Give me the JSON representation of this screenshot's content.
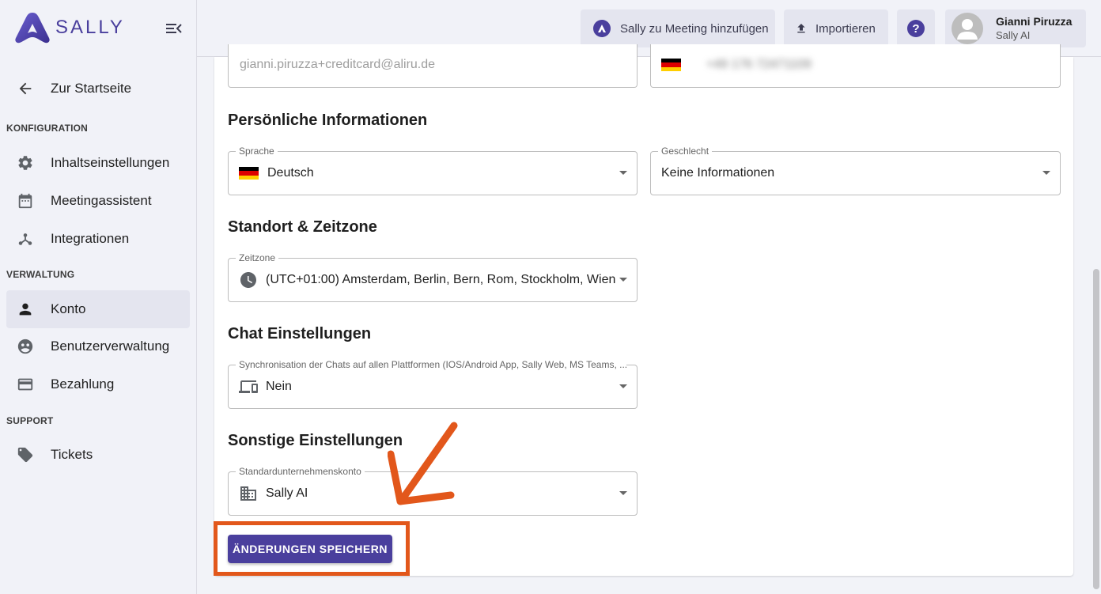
{
  "sidebar": {
    "logo_text": "SALLY",
    "back_label": "Zur Startseite",
    "sections": {
      "konfiguration": "KONFIGURATION",
      "verwaltung": "VERWALTUNG",
      "support": "SUPPORT"
    },
    "items": {
      "inhaltseinstellungen": "Inhaltseinstellungen",
      "meetingassistent": "Meetingassistent",
      "integrationen": "Integrationen",
      "konto": "Konto",
      "benutzerverwaltung": "Benutzerverwaltung",
      "bezahlung": "Bezahlung",
      "tickets": "Tickets"
    },
    "active_item": "Konto"
  },
  "topbar": {
    "add_meeting_label": "Sally zu Meeting hinzufügen",
    "import_label": "Importieren",
    "user_name": "Gianni Piruzza",
    "user_org": "Sally AI"
  },
  "form": {
    "email_value": "gianni.piruzza+creditcard@aliru.de",
    "phone_value": "+49 176 72471109",
    "personal_title": "Persönliche Informationen",
    "sprache_label": "Sprache",
    "sprache_value": "Deutsch",
    "geschlecht_label": "Geschlecht",
    "geschlecht_value": "Keine Informationen",
    "standort_title": "Standort & Zeitzone",
    "zeitzone_label": "Zeitzone",
    "zeitzone_value": "(UTC+01:00) Amsterdam, Berlin, Bern, Rom, Stockholm, Wien",
    "chat_title": "Chat Einstellungen",
    "sync_label": "Synchronisation der Chats auf allen Plattformen (IOS/Android App, Sally Web, MS Teams, ...",
    "sync_value": "Nein",
    "sonstige_title": "Sonstige Einstellungen",
    "konto_label": "Standardunternehmenskonto",
    "konto_value": "Sally AI",
    "save_label": "ÄNDERUNGEN SPEICHERN"
  },
  "colors": {
    "brand": "#4a3f9d",
    "highlight": "#e2571b"
  }
}
